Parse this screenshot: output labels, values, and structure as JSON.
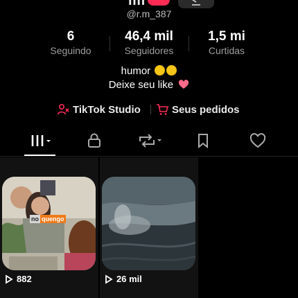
{
  "profile": {
    "top_name": "mi",
    "username": "@r.m_387"
  },
  "stats": [
    {
      "value": "6",
      "label": "Seguindo"
    },
    {
      "value": "46,4 mil",
      "label": "Seguidores"
    },
    {
      "value": "1,5 mi",
      "label": "Curtidas"
    }
  ],
  "bio": {
    "line1": "humor",
    "line2": "Deixe seu like"
  },
  "links": {
    "studio": "TikTok Studio",
    "orders": "Seus pedidos"
  },
  "tabs": [
    "videos-grid",
    "private",
    "reposts",
    "favorites",
    "liked"
  ],
  "videos": [
    {
      "views": "882",
      "overlay_text_a": "no",
      "overlay_text_b": "quengo"
    },
    {
      "views": "26 mil"
    }
  ],
  "colors": {
    "accent": "#fe2c55",
    "background": "#000000",
    "muted_text": "#9e9e9e"
  }
}
